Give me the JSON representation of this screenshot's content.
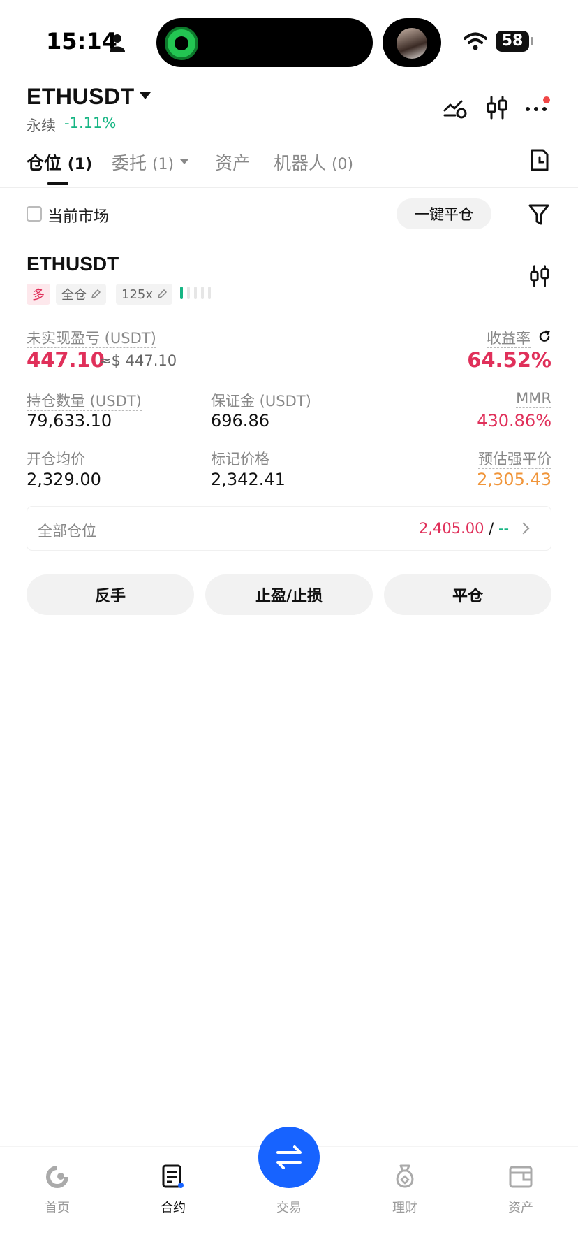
{
  "status_bar": {
    "time": "15:14",
    "battery": "58"
  },
  "header": {
    "symbol": "ETHUSDT",
    "contract_type": "永续",
    "change": "-1.11%"
  },
  "tabs": [
    {
      "label": "仓位",
      "count": "(1)"
    },
    {
      "label": "委托",
      "count": "(1)"
    },
    {
      "label": "资产",
      "count": ""
    },
    {
      "label": "机器人",
      "count": "(0)"
    }
  ],
  "filter_row": {
    "current_market": "当前市场",
    "close_all": "一键平仓"
  },
  "position": {
    "symbol": "ETHUSDT",
    "side": "多",
    "margin_mode": "全仓",
    "leverage": "125x",
    "leverage_level": 0.2,
    "unrealized_pnl_label": "未实现盈亏 (USDT)",
    "unrealized_pnl": "447.10",
    "unrealized_pnl_usd": "≈$ 447.10",
    "roe_label": "收益率",
    "roe": "64.52%",
    "size_label": "持仓数量 (USDT)",
    "size": "79,633.10",
    "margin_label": "保证金 (USDT)",
    "margin": "696.86",
    "mmr_label": "MMR",
    "mmr": "430.86%",
    "entry_label": "开仓均价",
    "entry": "2,329.00",
    "mark_label": "标记价格",
    "mark": "2,342.41",
    "liq_label": "预估强平价",
    "liq": "2,305.43",
    "all_positions_label": "全部仓位",
    "all_positions_value": "2,405.00",
    "all_positions_sep": "/",
    "all_positions_other": "--",
    "buttons": {
      "reverse": "反手",
      "tpsl": "止盈/止损",
      "close": "平仓"
    }
  },
  "bottom_nav": [
    {
      "label": "首页",
      "icon": "home-icon"
    },
    {
      "label": "合约",
      "icon": "futures-icon"
    },
    {
      "label": "交易",
      "icon": "swap-icon"
    },
    {
      "label": "理财",
      "icon": "earn-icon"
    },
    {
      "label": "资产",
      "icon": "wallet-icon"
    }
  ],
  "colors": {
    "red": "#e0305a",
    "green": "#16b583",
    "orange": "#f0953a",
    "blue": "#1763ff"
  }
}
